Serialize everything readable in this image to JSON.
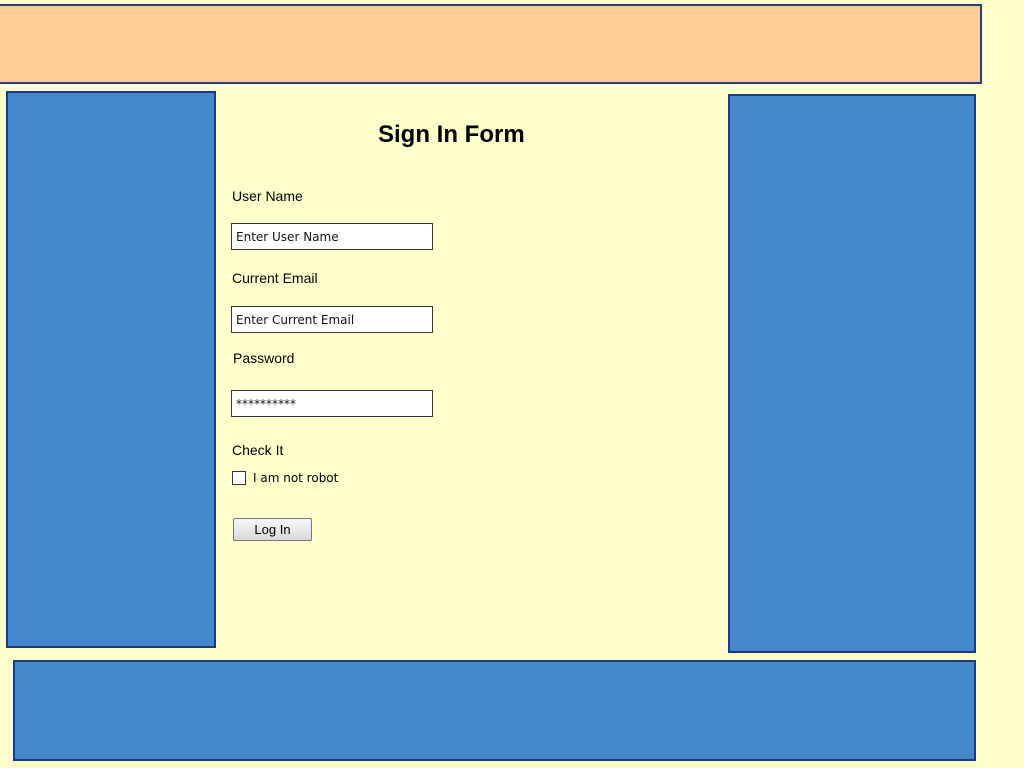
{
  "form": {
    "title": "Sign In Form",
    "username_label": "User Name",
    "username_placeholder": "Enter User Name",
    "email_label": "Current Email",
    "email_placeholder": "Enter Current Email",
    "password_label": "Password",
    "password_value": "**********",
    "check_label": "Check It",
    "robot_checkbox_label": "I am not robot",
    "robot_checked": false,
    "login_button_label": "Log In"
  },
  "colors": {
    "page_background": "#FFFFCC",
    "header_fill": "#FECC99",
    "panel_fill": "#4487CC",
    "panel_border": "#1B3A80"
  }
}
